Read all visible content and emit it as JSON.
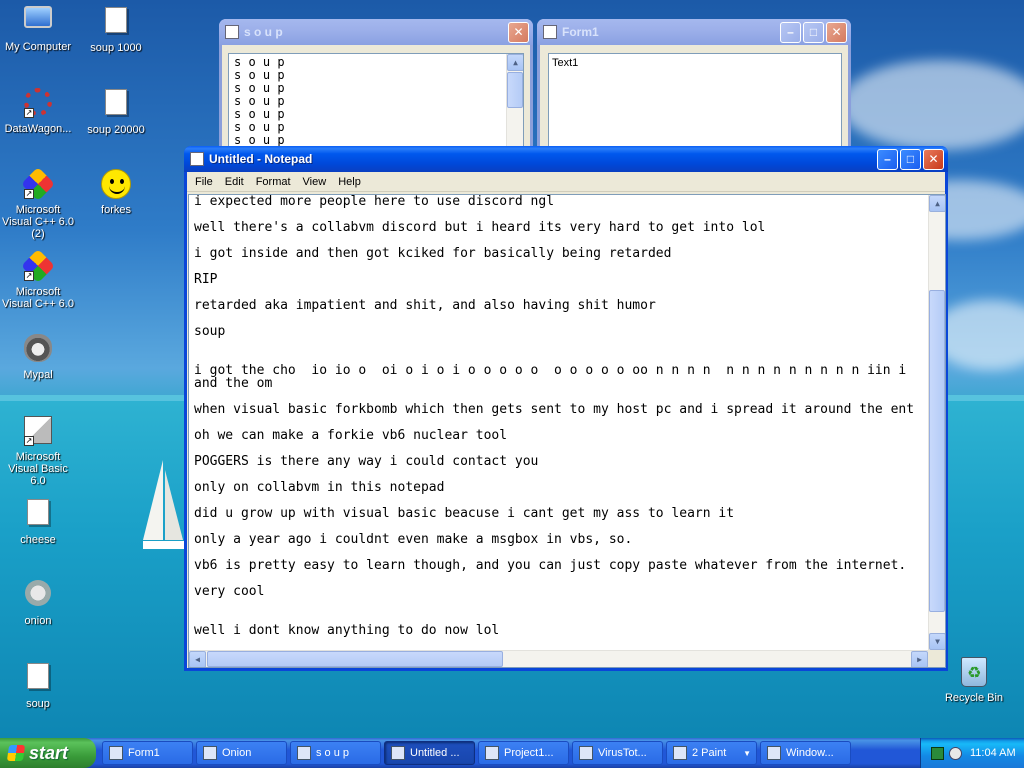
{
  "desktop": {
    "icons": [
      {
        "label": "My Computer",
        "icon": "my-computer-icon"
      },
      {
        "label": "soup 1000",
        "icon": "text-file-icon"
      },
      {
        "label": "DataWagon...",
        "icon": "datawagon-icon"
      },
      {
        "label": "soup 20000",
        "icon": "text-file-icon"
      },
      {
        "label": "Microsoft Visual C++ 6.0 (2)",
        "icon": "visual-cpp-icon"
      },
      {
        "label": "forkes",
        "icon": "smiley-icon"
      },
      {
        "label": "Microsoft Visual C++ 6.0",
        "icon": "visual-cpp-icon"
      },
      {
        "label": "Mypal",
        "icon": "mypal-raccoon-icon"
      },
      {
        "label": "Microsoft Visual Basic 6.0",
        "icon": "visual-basic-icon"
      },
      {
        "label": "cheese",
        "icon": "text-file-icon"
      },
      {
        "label": "onion",
        "icon": "onion-icon"
      },
      {
        "label": "soup",
        "icon": "text-file-icon"
      },
      {
        "label": "Recycle Bin",
        "icon": "recycle-bin-icon"
      }
    ]
  },
  "soup_window": {
    "title": "s o u p",
    "lines": [
      "s o u p",
      "s o u p",
      "s o u p",
      "s o u p",
      "s o u p",
      "s o u p",
      "s o u p"
    ]
  },
  "form1_window": {
    "title": "Form1",
    "textbox_value": "Text1"
  },
  "notepad": {
    "title": "Untitled - Notepad",
    "menu": [
      "File",
      "Edit",
      "Format",
      "View",
      "Help"
    ],
    "lines": [
      "i expected more people here to use discord ngl",
      "well there's a collabvm discord but i heard its very hard to get into lol",
      "i got inside and then got kciked for basically being retarded",
      "RIP",
      "retarded aka impatient and shit, and also having shit humor",
      "soup",
      "i got the cho  io io o  oi o i o i o o o o o  o o o o o oo n n n n  n n n n n n n n n iin i",
      "and the om",
      "when visual basic forkbomb which then gets sent to my host pc and i spread it around the ent",
      "oh we can make a forkie vb6 nuclear tool",
      "POGGERS is there any way i could contact you",
      "only on collabvm in this notepad",
      "did u grow up with visual basic beacuse i cant get my ass to learn it",
      "only a year ago i couldnt even make a msgbox in vbs, so.",
      "vb6 is pretty easy to learn though, and you can just copy paste whatever from the internet.",
      "very cool",
      "well i dont know anything to do now lol"
    ]
  },
  "taskbar": {
    "start_label": "start",
    "tasks": [
      {
        "label": "Form1",
        "icon": "vb-form-icon"
      },
      {
        "label": "Onion",
        "icon": "onion-icon"
      },
      {
        "label": "s o u p",
        "icon": "vb-form-icon"
      },
      {
        "label": "Untitled ...",
        "icon": "notepad-icon"
      },
      {
        "label": "Project1...",
        "icon": "visual-basic-icon"
      },
      {
        "label": "VirusTot...",
        "icon": "mypal-raccoon-icon"
      },
      {
        "label": "2 Paint",
        "icon": "paint-icon"
      },
      {
        "label": "Window...",
        "icon": "window-icon"
      }
    ],
    "clock": "11:04 AM"
  }
}
